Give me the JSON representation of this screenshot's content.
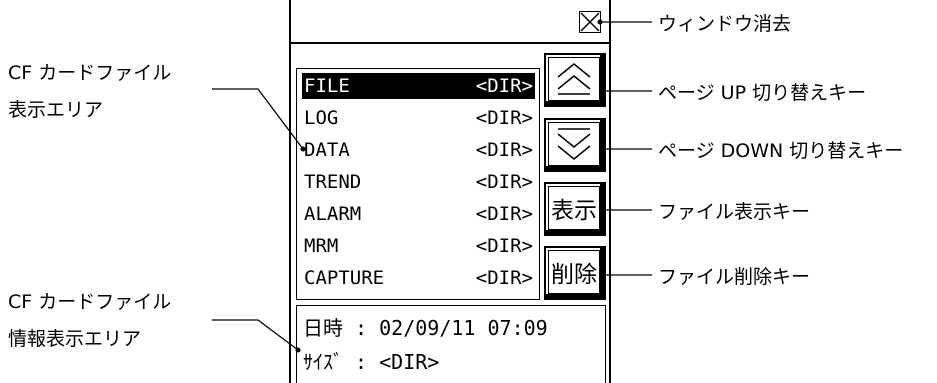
{
  "window": {
    "close_icon": "close-x-icon"
  },
  "file_list": {
    "rows": [
      {
        "name": "FILE",
        "type": "<DIR>",
        "selected": true
      },
      {
        "name": "LOG",
        "type": "<DIR>",
        "selected": false
      },
      {
        "name": "DATA",
        "type": "<DIR>",
        "selected": false
      },
      {
        "name": "TREND",
        "type": "<DIR>",
        "selected": false
      },
      {
        "name": "ALARM",
        "type": "<DIR>",
        "selected": false
      },
      {
        "name": "MRM",
        "type": "<DIR>",
        "selected": false
      },
      {
        "name": "CAPTURE",
        "type": "<DIR>",
        "selected": false
      }
    ]
  },
  "keys": {
    "page_up_icon": "double-chevron-up-icon",
    "page_down_icon": "double-chevron-down-icon",
    "display_label": "表示",
    "delete_label": "削除"
  },
  "info": {
    "date_line": "日時 : 02/09/11 07:09",
    "size_line": "ｻｲｽﾞ : <DIR>"
  },
  "annotations": {
    "file_area_line1": "CF カードファイル",
    "file_area_line2": "表示エリア",
    "info_area_line1": "CF カードファイル",
    "info_area_line2": "情報表示エリア",
    "close": "ウィンドウ消去",
    "page_up": "ページ UP 切り替えキー",
    "page_down": "ページ DOWN 切り替えキー",
    "display_key": "ファイル表示キー",
    "delete_key": "ファイル削除キー"
  }
}
